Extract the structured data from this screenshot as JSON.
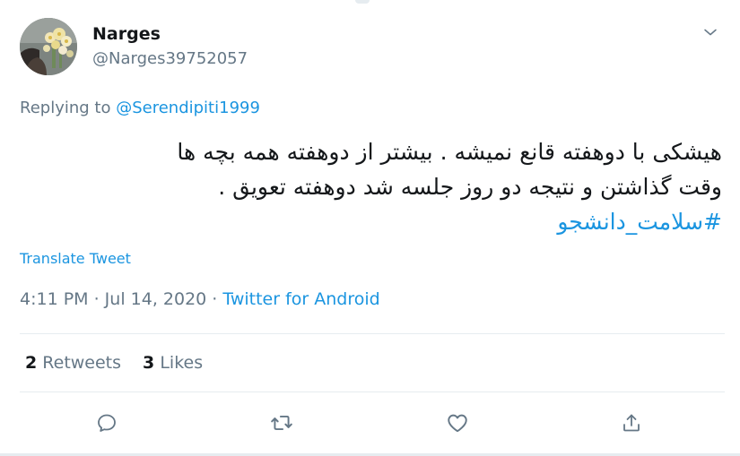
{
  "tweet": {
    "author": {
      "display_name": "Narges",
      "handle": "@Narges39752057"
    },
    "reply_context": {
      "prefix": "Replying to",
      "mention": "@Serendipiti1999"
    },
    "text_lines": [
      "هیشکی با دوهفته قانع نمیشه . بیشتر از دوهفته همه بچه ها",
      "وقت گذاشتن و نتیجه دو روز جلسه شد دوهفته تعویق ."
    ],
    "hashtag": "#سلامت_دانشجو",
    "translate_label": "Translate Tweet",
    "timestamp": "4:11 PM · Jul 14, 2020 · ",
    "source": "Twitter for Android",
    "stats": {
      "retweets_count": "2",
      "retweets_label": "Retweets",
      "likes_count": "3",
      "likes_label": "Likes"
    },
    "actions": {
      "reply_icon": "reply-icon",
      "retweet_icon": "retweet-icon",
      "like_icon": "heart-icon",
      "share_icon": "share-icon"
    }
  },
  "colors": {
    "link_blue": "#1b95e0",
    "secondary_text": "#657786",
    "primary_text": "#14171a",
    "divider": "#e6ecf0"
  }
}
